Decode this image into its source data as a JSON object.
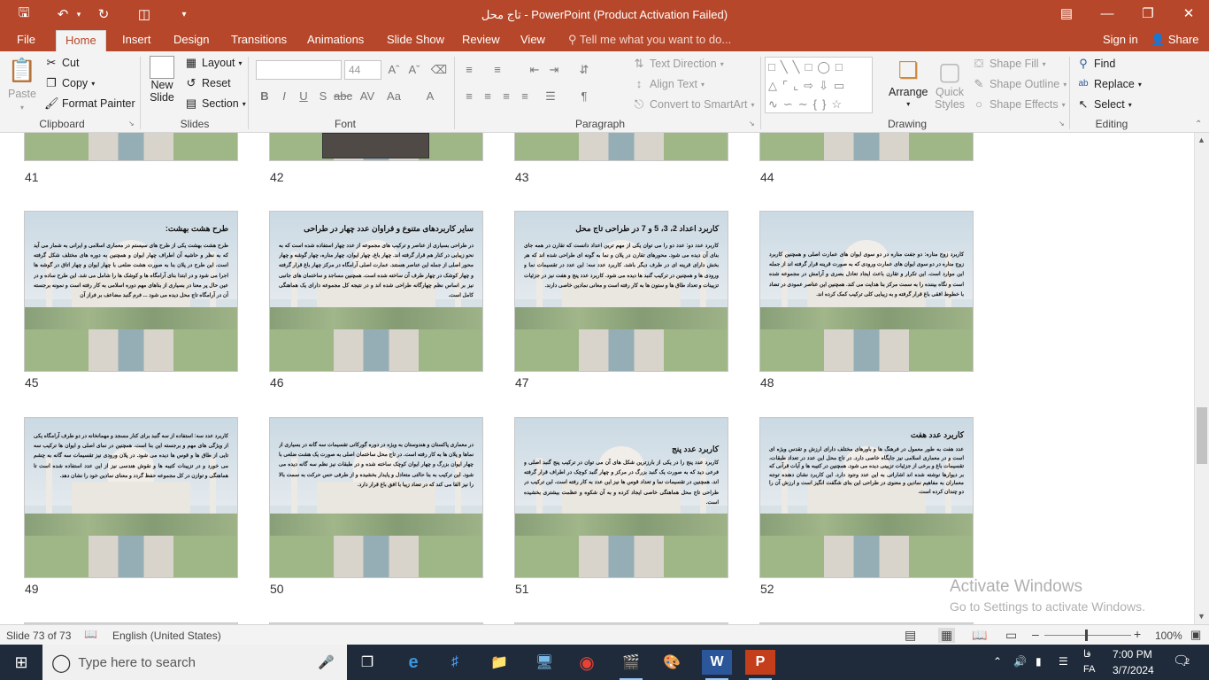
{
  "window": {
    "title": "تاج محل  -  PowerPoint (Product Activation Failed)",
    "icons": [
      "save-icon",
      "undo-icon",
      "redo-icon",
      "presenter-icon",
      "customize-icon"
    ]
  },
  "tabs": [
    {
      "label": "File",
      "active": false
    },
    {
      "label": "Home",
      "active": true
    },
    {
      "label": "Insert",
      "active": false
    },
    {
      "label": "Design",
      "active": false
    },
    {
      "label": "Transitions",
      "active": false
    },
    {
      "label": "Animations",
      "active": false
    },
    {
      "label": "Slide Show",
      "active": false
    },
    {
      "label": "Review",
      "active": false
    },
    {
      "label": "View",
      "active": false
    }
  ],
  "tell_me": "Tell me what you want to do...",
  "account": {
    "sign_in": "Sign in",
    "share": "Share"
  },
  "ribbon": {
    "clipboard": {
      "label": "Clipboard",
      "paste": "Paste",
      "cut": "Cut",
      "copy": "Copy",
      "format_painter": "Format Painter"
    },
    "slides": {
      "label": "Slides",
      "new_slide": "New",
      "new_slide2": "Slide",
      "layout": "Layout",
      "reset": "Reset",
      "section": "Section"
    },
    "font": {
      "label": "Font",
      "font_name": "",
      "font_size": "44"
    },
    "paragraph": {
      "label": "Paragraph",
      "text_direction": "Text Direction",
      "align_text": "Align Text",
      "smartart": "Convert to SmartArt"
    },
    "drawing": {
      "label": "Drawing",
      "arrange": "Arrange",
      "quick": "Quick",
      "styles": "Styles",
      "shape_fill": "Shape Fill",
      "shape_outline": "Shape Outline",
      "shape_effects": "Shape Effects"
    },
    "editing": {
      "label": "Editing",
      "find": "Find",
      "replace": "Replace",
      "select": "Select"
    }
  },
  "slides_top_row": {
    "numbers": [
      "41",
      "42",
      "43",
      "44"
    ]
  },
  "slides": [
    {
      "num": "45",
      "title": "طرح هشت بهشت:",
      "body": "طرح هشت بهشت یکی از طرح های سیستم در معماری اسلامی و ایرانی به شمار می آید که به نظر و حاشیه آن اطراف چهار ایوان و همچنین به دوره های مختلف شکل گرفته است. این طرح در پلان بنا به صورت هشت ضلعی با چهار ایوان و چهار اتاق در گوشه ها اجرا می شود و در ابتدا بنای آرامگاه ها و کوشک ها را شامل می شد. این طرح ساده و در عین حال پر معنا در بسیاری از بناهای مهم دوره اسلامی به کار رفته است و نمونه برجسته آن در آرامگاه تاج محل دیده می شود ... فرم گنبد مضاعف بر فراز آن"
    },
    {
      "num": "46",
      "title": "سایر کاربردهای متنوع و فراوان عدد چهار در طراحی",
      "body": "در طراحی بسیاری از عناصر و ترکیب های مجموعه از عدد چهار استفاده شده است که به نحو زیبایی در کنار هم قرار گرفته اند. چهار باغ، چهار ایوان، چهار مناره، چهار گوشه و چهار محور اصلی از جمله این عناصر هستند. عمارت اصلی آرامگاه در مرکز چهار باغ قرار گرفته و چهار کوشک در چهار طرف آن ساخته شده است. همچنین مساجد و ساختمان های جانبی نیز بر اساس نظم چهارگانه طراحی شده اند و در نتیجه کل مجموعه دارای یک هماهنگی کامل است."
    },
    {
      "num": "47",
      "title": "کاربرد اعداد 2، 3، 5 و 7 در طراحی تاج محل",
      "body": "کاربرد عدد دو: عدد دو را می توان یکی از مهم ترین اعداد دانست که تقارن در همه جای بنای آن دیده می شود. محورهای تقارن در پلان و نما به گونه ای طراحی شده اند که هر بخش دارای قرینه ای در طرف دیگر باشد. کاربرد عدد سه: این عدد در تقسیمات نما و ورودی ها و همچنین در ترکیب گنبد ها دیده می شود. کاربرد عدد پنج و هفت نیز در جزئیات تزیینات و تعداد طاق ها و ستون ها به کار رفته است و معانی نمادین خاصی دارند."
    },
    {
      "num": "48",
      "title": "",
      "body": "کاربرد زوج مناره: دو جفت مناره در دو سوی ایوان های عمارت اصلی و همچنین کاربرد زوج مناره در دو سوی ایوان های عمارت ورودی که به صورت قرینه قرار گرفته اند از جمله این موارد است. این تکرار و تقارن باعث ایجاد تعادل بصری و آرامش در مجموعه شده است و نگاه بیننده را به سمت مرکز بنا هدایت می کند. همچنین این عناصر عمودی در تضاد با خطوط افقی باغ قرار گرفته و به زیبایی کلی ترکیب کمک کرده اند."
    },
    {
      "num": "49",
      "title": "",
      "body": "کاربرد عدد سه: استفاده از سه گنبد برای کنار مسجد و مهمانخانه در دو طرف آرامگاه یکی از ویژگی های مهم و برجسته این بنا است. همچنین در نمای اصلی و ایوان ها ترکیب سه تایی از طاق ها و قوس ها دیده می شود. در پلان ورودی نیز تقسیمات سه گانه به چشم می خورد و در تزیینات کتیبه ها و نقوش هندسی نیز از این عدد استفاده شده است تا هماهنگی و توازن در کل مجموعه حفظ گردد و معنای نمادین خود را نشان دهد."
    },
    {
      "num": "50",
      "title": "",
      "body": "در معماری پاکستان و هندوستان به ویژه در دوره گورکانی تقسیمات سه گانه در بسیاری از نماها و پلان ها به کار رفته است. در تاج محل ساختمان اصلی به صورت یک هشت ضلعی با چهار ایوان بزرگ و چهار ایوان کوچک ساخته شده و در طبقات نیز نظم سه گانه دیده می شود. این ترکیب به بنا حالتی متعادل و پایدار بخشیده و از طرفی حس حرکت به سمت بالا را نیز القا می کند که در تضاد زیبا با افق باغ قرار دارد."
    },
    {
      "num": "51",
      "title": "کاربرد عدد پنج",
      "body": "کاربرد عدد پنج را در یکی از بارزترین شکل های آن می توان در ترکیب پنج گنبد اصلی و فرعی دید که به صورت یک گنبد بزرگ در مرکز و چهار گنبد کوچک در اطراف قرار گرفته اند. همچنین در تقسیمات نما و تعداد قوس ها نیز این عدد به کار رفته است. این ترکیب در طراحی تاج محل هماهنگی خاصی ایجاد کرده و به آن شکوه و عظمت بیشتری بخشیده است."
    },
    {
      "num": "52",
      "title": "کاربرد عدد هفت",
      "body": "عدد هفت به طور معمول در فرهنگ ها و باورهای مختلف دارای ارزش و تقدس ویژه ای است و در معماری اسلامی نیز جایگاه خاصی دارد. در تاج محل این عدد در تعداد طبقات، تقسیمات باغ و برخی از جزئیات تزیینی دیده می شود. همچنین در کتیبه ها و آیات قرآنی که بر دیوارها نوشته شده اند اشاراتی به این عدد وجود دارد. این کاربرد نشان دهنده توجه معماران به مفاهیم نمادین و معنوی در طراحی این بنای شگفت انگیز است و ارزش آن را دو چندان کرده است."
    }
  ],
  "watermark": {
    "line1": "Activate Windows",
    "line2": "Go to Settings to activate Windows."
  },
  "status": {
    "slide_counter": "Slide 73 of 73",
    "language": "English (United States)",
    "zoom": "100%"
  },
  "taskbar": {
    "search_placeholder": "Type here to search",
    "time": "7:00 PM",
    "date": "3/7/2024",
    "lang": "FA",
    "lang2": "فا",
    "notifications": "2"
  }
}
